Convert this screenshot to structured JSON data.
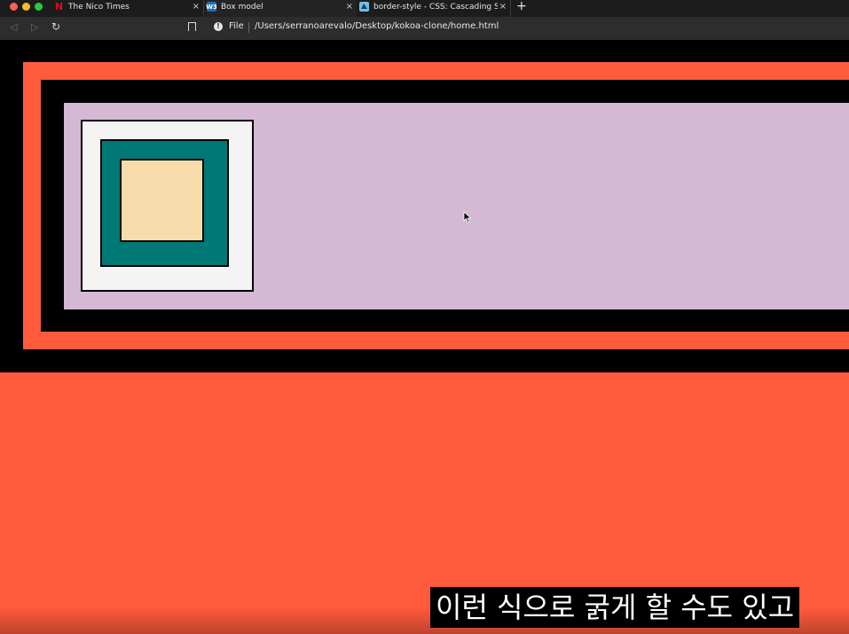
{
  "browser": {
    "tabs": [
      {
        "title": "The Nico Times",
        "icon": "N",
        "close": "×"
      },
      {
        "title": "Box model",
        "icon": "W3",
        "close": "×"
      },
      {
        "title": "border-style - CSS: Cascading S",
        "icon": "",
        "close": "×"
      }
    ],
    "new_tab": "+",
    "nav": {
      "back": "◁",
      "forward": "▷",
      "reload": "↻"
    },
    "address": {
      "scheme": "File",
      "url": "/Users/serranoarevalo/Desktop/kokoa-clone/home.html",
      "info_icon": "!"
    }
  },
  "page": {
    "colors": {
      "tomato": "#ff5a3c",
      "black": "#000000",
      "thistle": "#d4b8d4",
      "whitesmoke": "#f4f4f4",
      "teal": "#007875",
      "wheat": "#f5dcaa"
    }
  },
  "subtitle": "이런 식으로 굵게 할 수도 있고"
}
